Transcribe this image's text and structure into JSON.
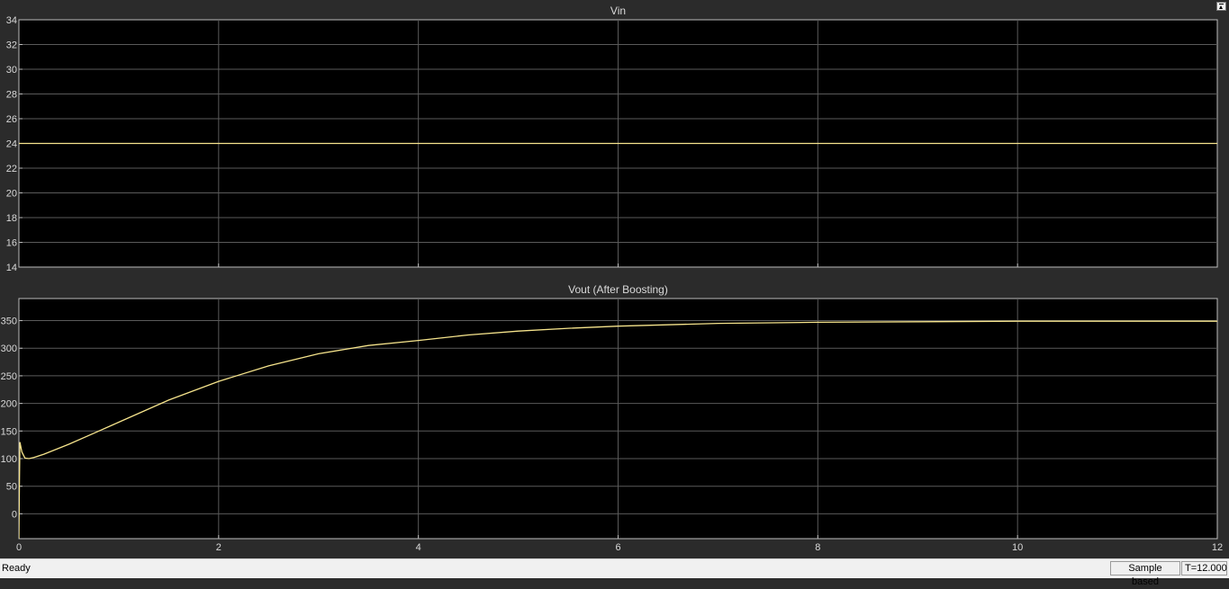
{
  "window": {
    "undock_icon": "undock-icon"
  },
  "status": {
    "text": "Ready",
    "sample_mode": "Sample based",
    "time": "T=12.000"
  },
  "colors": {
    "background": "#2b2b2b",
    "plot_area": "#000000",
    "grid": "#5a5a5a",
    "trace": "#f6e48c",
    "text": "#d9d9d9"
  },
  "chart_data": [
    {
      "type": "line",
      "title": "Vin",
      "xlabel": "",
      "ylabel": "",
      "xlim": [
        0,
        12
      ],
      "ylim": [
        14,
        34
      ],
      "x_ticks": [
        0,
        2,
        4,
        6,
        8,
        10,
        12
      ],
      "y_ticks": [
        14,
        16,
        18,
        20,
        22,
        24,
        26,
        28,
        30,
        32,
        34
      ],
      "grid": true,
      "series": [
        {
          "x": [
            0,
            12
          ],
          "y": [
            24,
            24
          ]
        }
      ]
    },
    {
      "type": "line",
      "title": "Vout (After Boosting)",
      "xlabel": "",
      "ylabel": "",
      "xlim": [
        0,
        12
      ],
      "ylim": [
        -45,
        390
      ],
      "x_ticks": [
        0,
        2,
        4,
        6,
        8,
        10,
        12
      ],
      "x_tick_labels": [
        "0",
        "2",
        "4",
        "6",
        "8",
        "10",
        "12"
      ],
      "y_ticks": [
        0,
        50,
        100,
        150,
        200,
        250,
        300,
        350
      ],
      "grid": true,
      "series": [
        {
          "x": [
            0,
            0.005,
            0.01,
            0.03,
            0.06,
            0.1,
            0.15,
            0.25,
            0.5,
            0.75,
            1,
            1.5,
            2,
            2.5,
            3,
            3.5,
            4,
            4.5,
            5,
            5.5,
            6,
            7,
            8,
            9,
            10,
            11,
            12
          ],
          "y": [
            -45,
            60,
            130,
            112,
            101,
            100,
            102,
            108,
            126,
            146,
            166,
            206,
            240,
            268,
            290,
            305,
            314,
            324,
            331,
            336,
            340,
            345,
            347,
            348,
            349,
            349,
            349
          ]
        }
      ]
    }
  ]
}
